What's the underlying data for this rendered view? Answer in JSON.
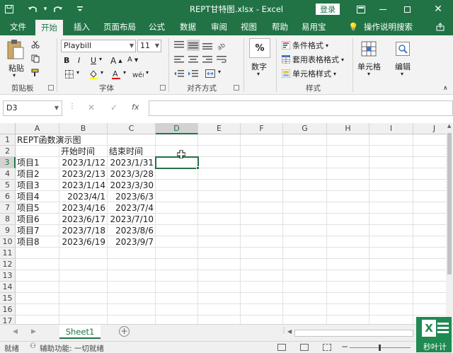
{
  "window": {
    "title": "REPT甘特图.xlsx - Excel",
    "login_label": "登录"
  },
  "tabs": [
    {
      "label": "文件"
    },
    {
      "label": "开始"
    },
    {
      "label": "插入"
    },
    {
      "label": "页面布局"
    },
    {
      "label": "公式"
    },
    {
      "label": "数据"
    },
    {
      "label": "审阅"
    },
    {
      "label": "视图"
    },
    {
      "label": "帮助"
    },
    {
      "label": "易用宝"
    },
    {
      "label": "操作说明搜索"
    }
  ],
  "ribbon": {
    "paste_label": "粘贴",
    "font_name": "Playbill",
    "font_size": "11",
    "number_label": "数字",
    "percent_symbol": "%",
    "conditional_format": "条件格式",
    "table_format": "套用表格格式",
    "cell_style": "单元格样式",
    "cells_label": "单元格",
    "edit_label": "编辑",
    "groups": {
      "clipboard": "剪贴板",
      "font": "字体",
      "alignment": "对齐方式",
      "styles": "样式"
    }
  },
  "formula_bar": {
    "name_box": "D3",
    "fx": "fx",
    "content": ""
  },
  "sheet": {
    "columns": [
      "A",
      "B",
      "C",
      "D",
      "E",
      "F",
      "G",
      "H",
      "I",
      "J"
    ],
    "rows": [
      "1",
      "2",
      "3",
      "4",
      "5",
      "6",
      "7",
      "8",
      "9",
      "10",
      "11",
      "12",
      "13",
      "14",
      "15",
      "16",
      "17"
    ],
    "title": "REPT函数演示图",
    "header_start": "开始时间",
    "header_end": "结束时间",
    "data": [
      {
        "name": "项目1",
        "start": "2023/1/12",
        "end": "2023/1/31"
      },
      {
        "name": "项目2",
        "start": "2023/2/13",
        "end": "2023/3/28"
      },
      {
        "name": "项目3",
        "start": "2023/1/14",
        "end": "2023/3/30"
      },
      {
        "name": "项目4",
        "start": "2023/4/1",
        "end": "2023/6/3"
      },
      {
        "name": "项目5",
        "start": "2023/4/16",
        "end": "2023/7/4"
      },
      {
        "name": "项目6",
        "start": "2023/6/17",
        "end": "2023/7/10"
      },
      {
        "name": "项目7",
        "start": "2023/7/18",
        "end": "2023/8/6"
      },
      {
        "name": "项目8",
        "start": "2023/6/19",
        "end": "2023/9/7"
      }
    ],
    "selected_column": "D",
    "selected_row": "3"
  },
  "sheet_tabs": [
    {
      "label": "Sheet1"
    }
  ],
  "status": {
    "accessibility": "辅助功能: 一切就绪"
  },
  "watermark": {
    "label": "秒叶计"
  },
  "colors": {
    "brand": "#217346",
    "ribbon_bg": "#f3f3f3"
  }
}
